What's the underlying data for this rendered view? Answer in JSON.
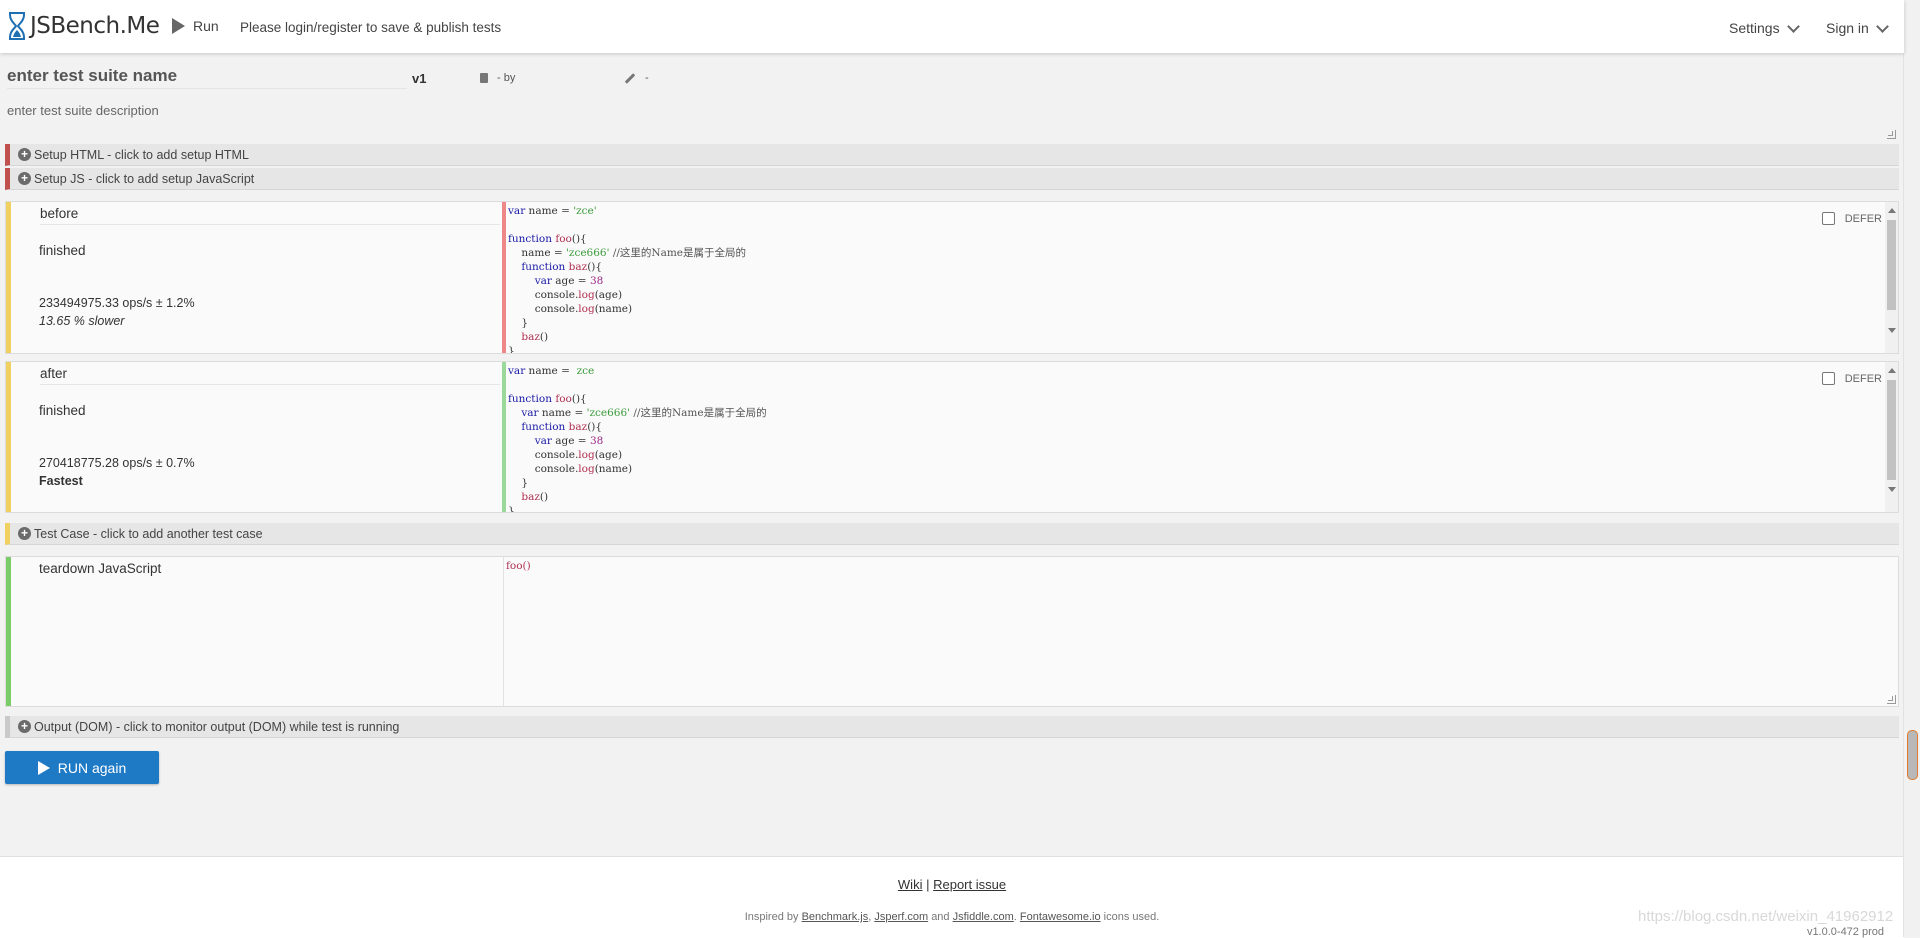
{
  "header": {
    "logo_text": "JSBench.Me",
    "run_label": "Run",
    "login_message": "Please login/register to save & publish tests",
    "settings_label": "Settings",
    "signin_label": "Sign in"
  },
  "suite": {
    "name": "enter test suite name",
    "version": "v1",
    "by_label": "- by",
    "edit_label": "-",
    "description": "enter test suite description"
  },
  "sections": {
    "setup_html": "Setup HTML - click to add setup HTML",
    "setup_js": "Setup JS - click to add setup JavaScript",
    "add_test_case": "Test Case - click to add another test case",
    "output_dom": "Output (DOM) - click to monitor output (DOM) while test is running"
  },
  "test_cases": [
    {
      "title": "before",
      "status": "finished",
      "ops": "233494975.33 ops/s ± 1.2%",
      "comparison": "13.65 % slower",
      "defer_label": "DEFER",
      "code": [
        "var name = 'zce'",
        "",
        "function foo(){",
        "    name = 'zce666' //这里的Name是属于全局的",
        "    function baz(){",
        "        var age = 38",
        "        console.log(age)",
        "        console.log(name)",
        "    }",
        "    baz()",
        "}"
      ]
    },
    {
      "title": "after",
      "status": "finished",
      "ops": "270418775.28 ops/s ± 0.7%",
      "comparison": "Fastest",
      "defer_label": "DEFER",
      "code": [
        "var name =  zce",
        "",
        "function foo(){",
        "    var name = 'zce666' //这里的Name是属于全局的",
        "    function baz(){",
        "        var age = 38",
        "        console.log(age)",
        "        console.log(name)",
        "    }",
        "    baz()",
        "}"
      ]
    }
  ],
  "teardown": {
    "title": "teardown JavaScript",
    "code": "foo()"
  },
  "run_again_label": "RUN again",
  "footer": {
    "wiki": "Wiki",
    "separator": "|",
    "report_issue": "Report issue",
    "inspired_prefix": "Inspired by",
    "benchmark": "Benchmark.js",
    "jsperf": "Jsperf.com",
    "and": "and",
    "jsfiddle": "Jsfiddle.com",
    "fontawesome": "Fontawesome.io",
    "icons_used": "icons used.",
    "version": "v1.0.0-472 prod"
  },
  "watermark": "https://blog.csdn.net/weixin_41962912",
  "colors": {
    "run_button": "#1f7ac6",
    "setup_html_accent": "#c9c9c9",
    "case_accent": "#f0d060",
    "teardown_accent": "#7acb6a",
    "before_code_accent": "#e88",
    "after_code_accent": "#9ad99a"
  }
}
